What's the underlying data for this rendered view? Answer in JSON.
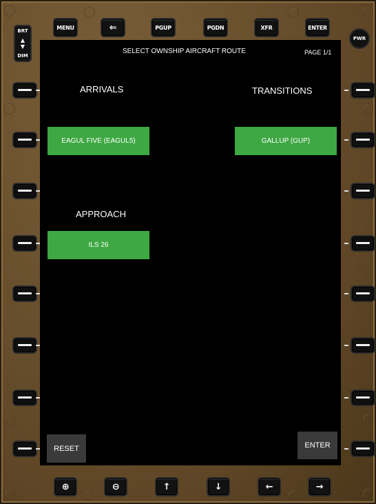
{
  "top_keys": [
    "MENU",
    "⇐",
    "PGUP",
    "PGDN",
    "XFR",
    "ENTER"
  ],
  "bottom_keys": [
    {
      "icon": "zoom-in-icon",
      "glyph": "⊕"
    },
    {
      "icon": "zoom-out-icon",
      "glyph": "⊖"
    },
    {
      "icon": "arrow-up-icon",
      "glyph": "↑"
    },
    {
      "icon": "arrow-down-icon",
      "glyph": "↓"
    },
    {
      "icon": "arrow-left-icon",
      "glyph": "←"
    },
    {
      "icon": "arrow-right-icon",
      "glyph": "→"
    }
  ],
  "brightness": {
    "top": "BRT",
    "bottom": "DIM"
  },
  "power_label": "PWR",
  "screen": {
    "title": "SELECT OWNSHIP AIRCRAFT ROUTE",
    "page": "PAGE 1/1",
    "arrivals_label": "ARRIVALS",
    "transitions_label": "TRANSITIONS",
    "approach_label": "APPROACH",
    "arrival_value": "EAGUL FIVE (EAGUL5)",
    "transition_value": "GALLUP (GUP)",
    "approach_value": "ILS 26",
    "reset_label": "RESET",
    "enter_label": "ENTER"
  },
  "colors": {
    "accent_green": "#3ea843",
    "bezel": "#6b5230",
    "button_gray": "#3a3a3a"
  }
}
